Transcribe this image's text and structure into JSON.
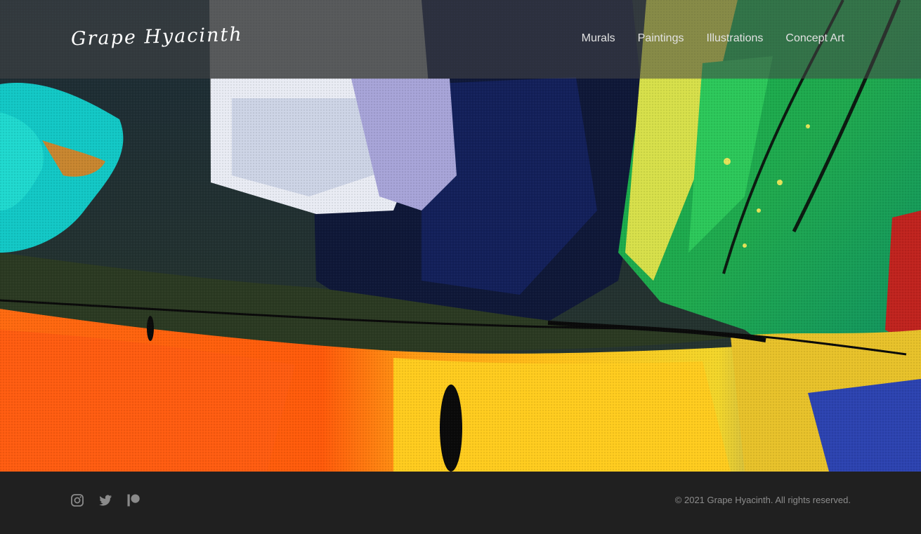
{
  "site": {
    "logo_text": "Grape Hyacinth"
  },
  "nav": {
    "items": [
      {
        "label": "Murals"
      },
      {
        "label": "Paintings"
      },
      {
        "label": "Illustrations"
      },
      {
        "label": "Concept Art"
      }
    ]
  },
  "footer": {
    "social_icons": [
      "instagram-icon",
      "twitter-icon",
      "patreon-icon"
    ],
    "copyright": "© 2021 Grape Hyacinth. All rights reserved."
  },
  "colors": {
    "header_overlay": "#464646",
    "footer_background": "#202020",
    "nav_text": "#e2e2e2",
    "footer_text": "#8d8d8d",
    "icon_color": "#8a8a8a"
  }
}
